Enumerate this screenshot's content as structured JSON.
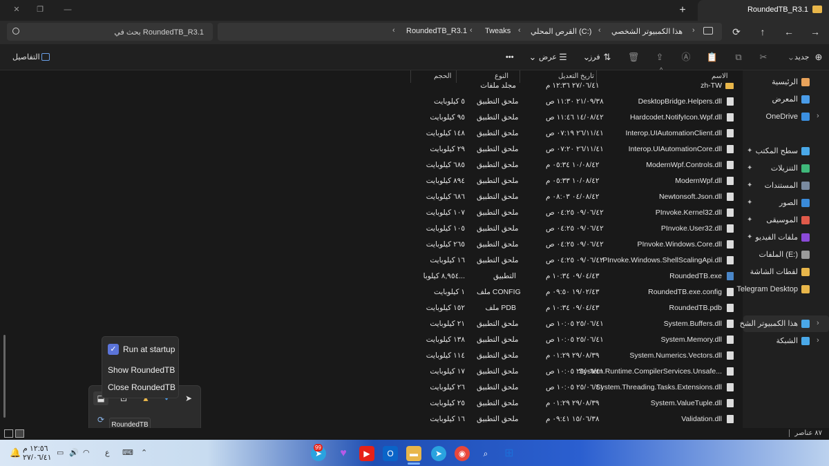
{
  "window": {
    "tab_title": "RoundedTB_R3.1",
    "new_tab": "+",
    "close": "✕"
  },
  "address": {
    "crumbs": [
      "هذا الكمبيوتر الشخصي",
      "القرص المحلي (C:)",
      "Tweaks",
      "RoundedTB_R3.1"
    ]
  },
  "search": {
    "placeholder": "بحث في RoundedTB_R3.1"
  },
  "toolbar": {
    "new_label": "جديد",
    "sort_label": "فرز",
    "view_label": "عرض",
    "more": "•••",
    "details_label": "التفاصيل"
  },
  "columns": {
    "name": "الاسم",
    "date": "تاريخ التعديل",
    "type": "النوع",
    "size": "الحجم"
  },
  "files": [
    {
      "name": "zh-TW",
      "date": "٢٧/٠٦/٤١ ١٢:٣٦ م",
      "type": "مجلد ملفات",
      "size": "",
      "kind": "folder"
    },
    {
      "name": "DesktopBridge.Helpers.dll",
      "date": "٢١/٠٩/٣٨ ١١:٣٠ ص",
      "type": "ملحق التطبيق",
      "size": "٥ كيلوبايت",
      "kind": "file"
    },
    {
      "name": "Hardcodet.NotifyIcon.Wpf.dll",
      "date": "١٤/٠٨/٤٢ ١١:٤٦ ص",
      "type": "ملحق التطبيق",
      "size": "٩٥ كيلوبايت",
      "kind": "file"
    },
    {
      "name": "Interop.UIAutomationClient.dll",
      "date": "٢٦/١١/٤١ ٠٧:١٩ ص",
      "type": "ملحق التطبيق",
      "size": "١٤٨ كيلوبايت",
      "kind": "file"
    },
    {
      "name": "Interop.UIAutomationCore.dll",
      "date": "٢٦/١١/٤١ ٠٧:٢٠ ص",
      "type": "ملحق التطبيق",
      "size": "٢٩ كيلوبايت",
      "kind": "file"
    },
    {
      "name": "ModernWpf.Controls.dll",
      "date": "١٠/٠٨/٤٢ ٠٥:٣٤ م",
      "type": "ملحق التطبيق",
      "size": "٦٨٥ كيلوبايت",
      "kind": "file"
    },
    {
      "name": "ModernWpf.dll",
      "date": "١٠/٠٨/٤٢ ٠٥:٣٣ م",
      "type": "ملحق التطبيق",
      "size": "٨٩٤ كيلوبايت",
      "kind": "file"
    },
    {
      "name": "Newtonsoft.Json.dll",
      "date": "٠٤/٠٨/٤٢ ٠٨:٠٣ م",
      "type": "ملحق التطبيق",
      "size": "٦٨٦ كيلوبايت",
      "kind": "file"
    },
    {
      "name": "PInvoke.Kernel32.dll",
      "date": "٠٩/٠٦/٤٢ ٠٤:٢٥ ص",
      "type": "ملحق التطبيق",
      "size": "١٠٧ كيلوبايت",
      "kind": "file"
    },
    {
      "name": "PInvoke.User32.dll",
      "date": "٠٩/٠٦/٤٢ ٠٤:٢٥ ص",
      "type": "ملحق التطبيق",
      "size": "١٠٥ كيلوبايت",
      "kind": "file"
    },
    {
      "name": "PInvoke.Windows.Core.dll",
      "date": "٠٩/٠٦/٤٢ ٠٤:٢٥ ص",
      "type": "ملحق التطبيق",
      "size": "٢٦٥ كيلوبايت",
      "kind": "file"
    },
    {
      "name": "PInvoke.Windows.ShellScalingApi.dll",
      "date": "٠٩/٠٦/٤٢ ٠٤:٢٥ ص",
      "type": "ملحق التطبيق",
      "size": "١٦ كيلوبايت",
      "kind": "file"
    },
    {
      "name": "RoundedTB.exe",
      "date": "٠٩/٠٤/٤٣ ١٠:٣٤ م",
      "type": "التطبيق",
      "size": "٨,٩٥٤ كيلوبا...",
      "kind": "exe"
    },
    {
      "name": "RoundedTB.exe.config",
      "date": "١٩/٠٢/٤٣ ٠٩:٥٠ م",
      "type": "ملف CONFIG",
      "size": "١ كيلوبايت",
      "kind": "file"
    },
    {
      "name": "RoundedTB.pdb",
      "date": "٠٩/٠٤/٤٣ ١٠:٣٤ م",
      "type": "ملف PDB",
      "size": "١٥٢ كيلوبايت",
      "kind": "file"
    },
    {
      "name": "System.Buffers.dll",
      "date": "٢٥/٠٦/٤١ ١٠:٠٥ ص",
      "type": "ملحق التطبيق",
      "size": "٢١ كيلوبايت",
      "kind": "file"
    },
    {
      "name": "System.Memory.dll",
      "date": "٢٥/٠٦/٤١ ١٠:٠٥ ص",
      "type": "ملحق التطبيق",
      "size": "١٣٨ كيلوبايت",
      "kind": "file"
    },
    {
      "name": "System.Numerics.Vectors.dll",
      "date": "٢٩/٠٨/٣٩ ٠١:٢٩ م",
      "type": "ملحق التطبيق",
      "size": "١١٤ كيلوبايت",
      "kind": "file"
    },
    {
      "name": "System.Runtime.CompilerServices.Unsafe...",
      "date": "٢٥/٠٦/٤١ ١٠:٠٥ ص",
      "type": "ملحق التطبيق",
      "size": "١٧ كيلوبايت",
      "kind": "file"
    },
    {
      "name": "System.Threading.Tasks.Extensions.dll",
      "date": "٢٥/٠٦/٤١ ١٠:٠٥ ص",
      "type": "ملحق التطبيق",
      "size": "٢٦ كيلوبايت",
      "kind": "file"
    },
    {
      "name": "System.ValueTuple.dll",
      "date": "٢٩/٠٨/٣٩ ٠١:٢٩ م",
      "type": "ملحق التطبيق",
      "size": "٢٥ كيلوبايت",
      "kind": "file"
    },
    {
      "name": "Validation.dll",
      "date": "١٥/٠٦/٣٨ ٠٩:٤١ م",
      "type": "ملحق التطبيق",
      "size": "١٦ كيلوبايت",
      "kind": "file"
    }
  ],
  "sidebar": {
    "items": [
      {
        "label": "الرئيسية",
        "color": "#e8a25a"
      },
      {
        "label": "المعرض",
        "color": "#4a9ce8"
      },
      {
        "label": "OneDrive",
        "color": "#3b8fe0"
      },
      {
        "label": "سطح المكتب",
        "color": "#4aa8e8"
      },
      {
        "label": "التنزيلات",
        "color": "#3fb87a"
      },
      {
        "label": "المستندات",
        "color": "#7a8aa0"
      },
      {
        "label": "الصور",
        "color": "#3a8ad8"
      },
      {
        "label": "الموسيقى",
        "color": "#e05a4a"
      },
      {
        "label": "ملفات الفيديو",
        "color": "#8a4ad8"
      },
      {
        "label": "الملفات (E:)",
        "color": "#9a9a9a"
      },
      {
        "label": "لقطات الشاشة",
        "color": "#e8b64a"
      },
      {
        "label": "Telegram Desktop",
        "color": "#e8b64a"
      },
      {
        "label": "هذا الكمبيوتر الشخ",
        "color": "#4aa8e8"
      },
      {
        "label": "الشبكة",
        "color": "#4aa8e8"
      }
    ]
  },
  "status": {
    "count": "٨٧ عناصر"
  },
  "tray_menu": {
    "run_at_startup": "Run at startup",
    "show": "Show RoundedTB",
    "close": "Close RoundedTB",
    "tooltip": "RoundedTB"
  },
  "taskbar": {
    "time": "١٢:٥٦ م",
    "date": "٢٧/٠٦/٤١",
    "lang": "ع",
    "badge": "99"
  }
}
